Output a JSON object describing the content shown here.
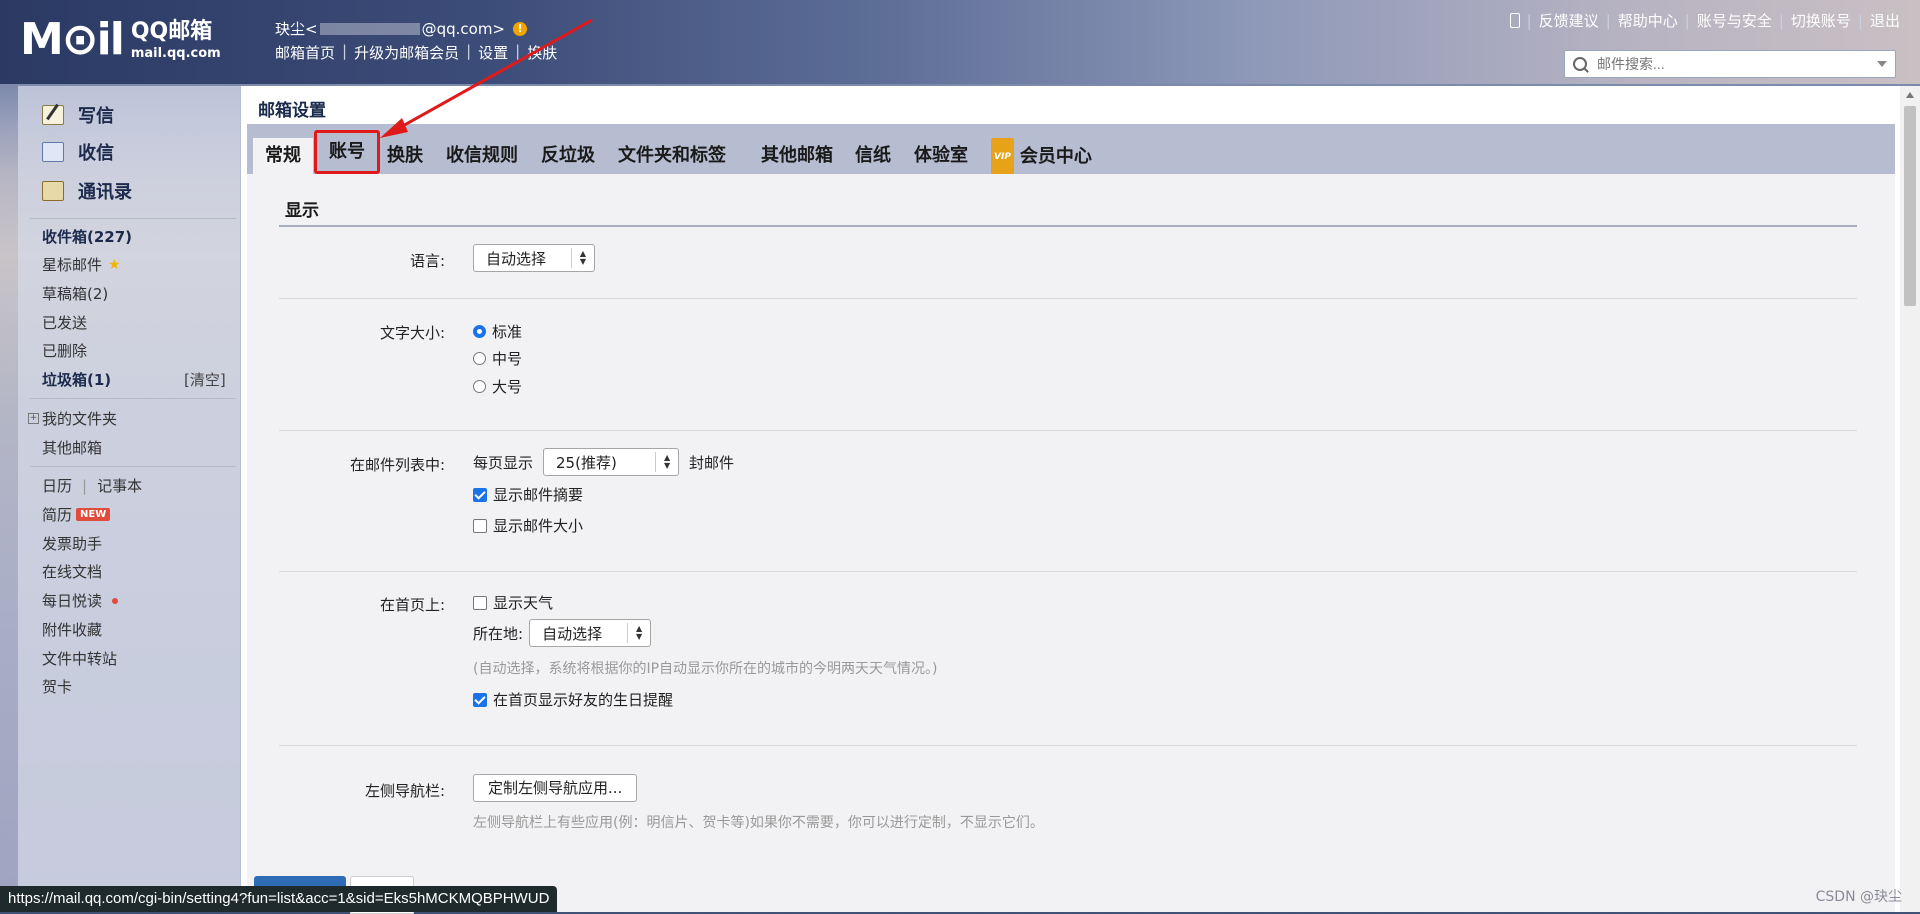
{
  "header": {
    "logo_mark": "M⊙il",
    "logo_brand": "QQ邮箱",
    "logo_domain": "mail.qq.com",
    "user_prefix": "玦尘<",
    "user_suffix": "@qq.com>",
    "warn_mark": "!",
    "links": [
      "邮箱首页",
      "升级为邮箱会员",
      "设置",
      "换肤"
    ],
    "right_links": [
      "反馈建议",
      "帮助中心",
      "账号与安全",
      "切换账号",
      "退出"
    ],
    "search_placeholder": "邮件搜索..."
  },
  "sidebar": {
    "compose": "写信",
    "inbox_action": "收信",
    "contacts": "通讯录",
    "inbox": "收件箱(227)",
    "starred": "星标邮件",
    "drafts": "草稿箱(2)",
    "sent": "已发送",
    "deleted": "已删除",
    "junk": "垃圾箱(1)",
    "junk_clear": "[清空]",
    "my_folders": "我的文件夹",
    "other_mailboxes": "其他邮箱",
    "calendar": "日历",
    "notebook": "记事本",
    "resume": "简历",
    "new_badge": "NEW",
    "invoice": "发票助手",
    "online_docs": "在线文档",
    "daily_read": "每日悦读",
    "attachments": "附件收藏",
    "file_transfer": "文件中转站",
    "greeting_card": "贺卡"
  },
  "main": {
    "page_title": "邮箱设置",
    "tabs": [
      "常规",
      "账号",
      "换肤",
      "收信规则",
      "反垃圾",
      "文件夹和标签",
      "其他邮箱",
      "信纸",
      "体验室",
      "会员中心"
    ],
    "vip_label": "VIP",
    "section_title": "显示",
    "language_label": "语言:",
    "language_value": "自动选择",
    "font_size_label": "文字大小:",
    "font_options": [
      "标准",
      "中号",
      "大号"
    ],
    "list_label": "在邮件列表中:",
    "per_page_prefix": "每页显示",
    "per_page_value": "25(推荐)",
    "per_page_suffix": "封邮件",
    "show_summary": "显示邮件摘要",
    "show_size": "显示邮件大小",
    "home_label": "在首页上:",
    "show_weather": "显示天气",
    "location_label": "所在地:",
    "location_value": "自动选择",
    "weather_hint": "(自动选择，系统将根据你的IP自动显示你所在的城市的今明两天天气情况。)",
    "birthday": "在首页显示好友的生日提醒",
    "nav_label": "左侧导航栏:",
    "nav_button": "定制左侧导航应用...",
    "nav_hint": "左侧导航栏上有些应用(例：明信片、贺卡等)如果你不需要，你可以进行定制，不显示它们。"
  },
  "statusbar": {
    "url": "https://mail.qq.com/cgi-bin/setting4?fun=list&acc=1&sid=Eks5hMCKMQBPHWUD"
  },
  "watermark": "CSDN @玦尘",
  "colors": {
    "accent": "#1a73e8",
    "annotation_red": "#e01a1a",
    "tabbar": "#b6bdd1"
  }
}
